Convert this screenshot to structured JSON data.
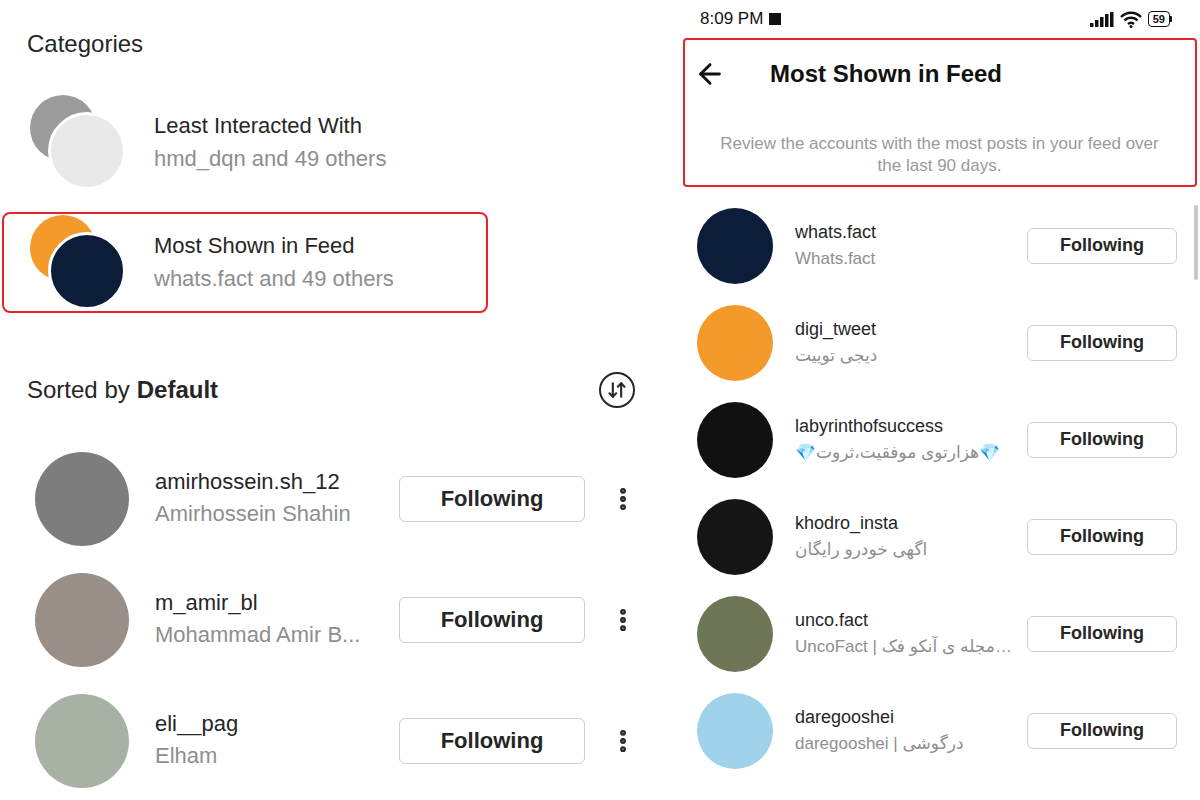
{
  "left": {
    "categories_title": "Categories",
    "categories": [
      {
        "title": "Least Interacted With",
        "subtitle": "hmd_dqn and 49 others",
        "highlighted": false,
        "avatar_colors": [
          "#9b9b9b",
          "#e9e9e9"
        ]
      },
      {
        "title": "Most Shown in Feed",
        "subtitle": "whats.fact and 49 others",
        "highlighted": true,
        "avatar_colors": [
          "#f39a2b",
          "#0c1d3a"
        ]
      }
    ],
    "sort": {
      "label": "Sorted by",
      "value": "Default"
    },
    "accounts": [
      {
        "username": "amirhossein.sh_12",
        "name": "Amirhossein Shahin",
        "button": "Following",
        "avatar_color": "#7d7d7d"
      },
      {
        "username": "m_amir_bl",
        "name": "Mohammad Amir B...",
        "button": "Following",
        "avatar_color": "#9a8f86"
      },
      {
        "username": "eli__pag",
        "name": "Elham",
        "button": "Following",
        "avatar_color": "#a7b2a4"
      }
    ]
  },
  "right": {
    "status_bar": {
      "time": "8:09 PM",
      "battery": "59"
    },
    "header": {
      "title": "Most Shown in Feed",
      "description": "Review the accounts with the most posts in your feed over the last 90 days.",
      "highlighted": true
    },
    "accounts": [
      {
        "username": "whats.fact",
        "name": "Whats.fact",
        "button": "Following",
        "avatar_color": "#0c1d3a"
      },
      {
        "username": "digi_tweet",
        "name": "دیجی توییت",
        "button": "Following",
        "avatar_color": "#f39a2b"
      },
      {
        "username": "labyrinthofsuccess",
        "name": "💎هزارتوی موفقیت،ثروت💎",
        "button": "Following",
        "avatar_color": "#111111"
      },
      {
        "username": "khodro_insta",
        "name": "اگهی خودرو رایگان",
        "button": "Following",
        "avatar_color": "#151515"
      },
      {
        "username": "unco.fact",
        "name": "UncoFact | مجله ی آنکو فک…",
        "button": "Following",
        "avatar_color": "#6e7658"
      },
      {
        "username": "daregooshei",
        "name": "daregooshei | درگوشی",
        "button": "Following",
        "avatar_color": "#9fd3ec"
      }
    ]
  }
}
